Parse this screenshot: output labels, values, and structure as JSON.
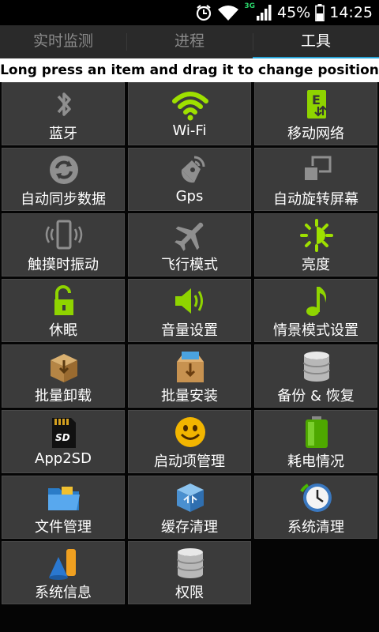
{
  "status_bar": {
    "network": "3G",
    "battery": "45%",
    "time": "14:25",
    "icons": [
      "alarm-icon",
      "wifi-icon",
      "signal-icon",
      "battery-icon"
    ]
  },
  "tabs": [
    {
      "label": "实时监测"
    },
    {
      "label": "进程"
    },
    {
      "label": "工具",
      "active": true
    }
  ],
  "hint": "Long press an item and drag it to change position",
  "tools": [
    {
      "label": "蓝牙",
      "icon": "bluetooth-icon"
    },
    {
      "label": "Wi-Fi",
      "icon": "wifi-icon"
    },
    {
      "label": "移动网络",
      "icon": "mobile-network-icon"
    },
    {
      "label": "自动同步数据",
      "icon": "sync-icon"
    },
    {
      "label": "Gps",
      "icon": "satellite-icon"
    },
    {
      "label": "自动旋转屏幕",
      "icon": "rotate-screen-icon"
    },
    {
      "label": "触摸时振动",
      "icon": "vibrate-icon"
    },
    {
      "label": "飞行模式",
      "icon": "airplane-icon"
    },
    {
      "label": "亮度",
      "icon": "brightness-icon"
    },
    {
      "label": "休眠",
      "icon": "unlock-icon"
    },
    {
      "label": "音量设置",
      "icon": "volume-icon"
    },
    {
      "label": "情景模式设置",
      "icon": "music-note-icon"
    },
    {
      "label": "批量卸载",
      "icon": "box-uninstall-icon"
    },
    {
      "label": "批量安装",
      "icon": "box-install-icon"
    },
    {
      "label": "备份 & 恢复",
      "icon": "database-icon"
    },
    {
      "label": "App2SD",
      "icon": "sd-card-icon"
    },
    {
      "label": "启动项管理",
      "icon": "smiley-icon"
    },
    {
      "label": "耗电情况",
      "icon": "battery-usage-icon"
    },
    {
      "label": "文件管理",
      "icon": "folder-icon"
    },
    {
      "label": "缓存清理",
      "icon": "recycle-cube-icon"
    },
    {
      "label": "系统清理",
      "icon": "clock-icon"
    },
    {
      "label": "系统信息",
      "icon": "shapes-icon"
    },
    {
      "label": "权限",
      "icon": "database-icon"
    }
  ]
}
